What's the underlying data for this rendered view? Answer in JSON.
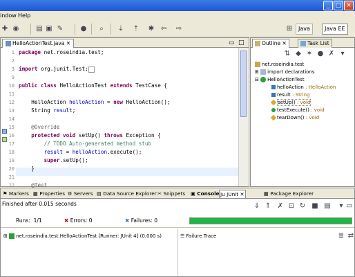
{
  "menu": {
    "window_label": "indow",
    "help_label": "Help"
  },
  "perspectives": {
    "java_label": "Java",
    "javaee_label": "Java EE"
  },
  "editor": {
    "tab_label": "HelloActionTest.java",
    "lines": [
      {
        "num": "1",
        "text": "package net.roseindia.test;"
      },
      {
        "num": "2",
        "text": ""
      },
      {
        "num": "3",
        "text": "import org.junit.Test;"
      },
      {
        "num": "9",
        "text": ""
      },
      {
        "num": "10",
        "text": "public class HelloActionTest extends TestCase {"
      },
      {
        "num": "11",
        "text": ""
      },
      {
        "num": "12",
        "text": "    HelloAction helloAction = new HelloAction();"
      },
      {
        "num": "13",
        "text": "    String result;"
      },
      {
        "num": "14",
        "text": ""
      },
      {
        "num": "15",
        "text": "    @Override"
      },
      {
        "num": "16",
        "text": "    protected void setUp() throws Exception {"
      },
      {
        "num": "17",
        "text": "        // TODO Auto-generated method stub"
      },
      {
        "num": "18",
        "text": "        result = helloAction.execute();"
      },
      {
        "num": "19",
        "text": "        super.setUp();"
      },
      {
        "num": "20",
        "text": "    }"
      },
      {
        "num": "21",
        "text": ""
      },
      {
        "num": "22",
        "text": "    @Test"
      }
    ]
  },
  "outline": {
    "tab_outline": "Outline",
    "tab_tasklist": "Task List",
    "items": [
      {
        "label": "net.roseindia.test"
      },
      {
        "label": "import declarations"
      },
      {
        "label": "HelloActionTest"
      },
      {
        "label": "helloAction",
        "type": ": HelloAction"
      },
      {
        "label": "result",
        "type": ": String"
      },
      {
        "label": "setUp()",
        "type": ": void"
      },
      {
        "label": "testExecute()",
        "type": ": void"
      },
      {
        "label": "tearDown()",
        "type": ": void"
      }
    ]
  },
  "bottom": {
    "tabs": [
      "Markers",
      "Properties",
      "Servers",
      "Data Source Explorer",
      "Snippets",
      "Console",
      "JUnit",
      "Package Explorer"
    ],
    "status": "Finished after 0.015 seconds",
    "runs_label": "Runs:",
    "runs_value": "1/1",
    "errors_label": "Errors:",
    "errors_value": "0",
    "failures_label": "Failures:",
    "failures_value": "0",
    "test_entry": "net.roseindia.test.HelloActionTest [Runner: JUnit 4] (0.000 s)",
    "failure_trace_label": "Failure Trace",
    "progress_status": "success",
    "progress_color": "#24b24a"
  }
}
